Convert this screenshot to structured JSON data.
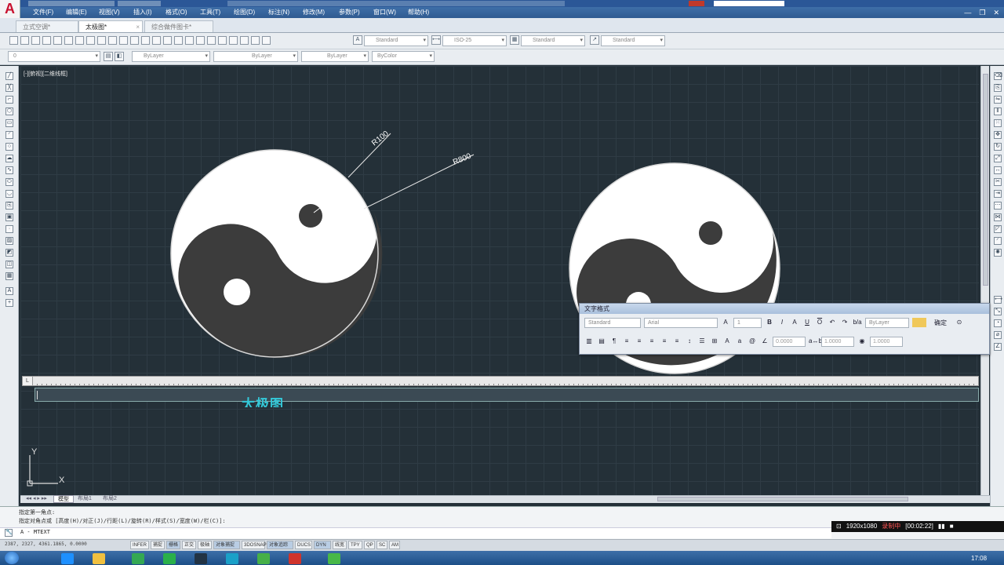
{
  "window": {
    "menus": [
      "文件(F)",
      "编辑(E)",
      "视图(V)",
      "插入(I)",
      "格式(O)",
      "工具(T)",
      "绘图(D)",
      "标注(N)",
      "修改(M)",
      "参数(P)",
      "窗口(W)",
      "帮助(H)"
    ],
    "controls": [
      "—",
      "❐",
      "✕"
    ]
  },
  "tabs": [
    {
      "label": "立式空调*"
    },
    {
      "label": "太极图*"
    },
    {
      "label": "综合做件图卡*"
    }
  ],
  "toolbar": {
    "text_style": "Standard",
    "dim_style": "ISO-25",
    "table_style": "Standard",
    "multileader_style": "Standard",
    "layer": "0",
    "color": "ByLayer",
    "linetype": "ByLayer",
    "lineweight": "ByLayer",
    "plotstyle": "ByColor"
  },
  "viewport": {
    "label": "[-][俯视][二维线框]"
  },
  "drawing": {
    "dim_small": "R100",
    "dim_large": "R800",
    "ucs_x": "X",
    "ucs_y": "Y",
    "colors": {
      "background": "#243038",
      "light": "#ffffff",
      "dark": "#3c3c3c",
      "accent": "#34c8d8"
    }
  },
  "text_format": {
    "title": "文字格式",
    "style": "Standard",
    "font": "Arial",
    "height": "1",
    "color": "ByLayer",
    "ok": "确定",
    "oblique": "0.0000",
    "tracking": "1.0000",
    "width_factor": "1.0000"
  },
  "mtext": {
    "content": "太极图",
    "ruler_corner": "L"
  },
  "layout_tabs": [
    "模型",
    "布局1",
    "布局2"
  ],
  "command": {
    "history_1": "指定第一角点:",
    "history_2": "指定对角点或 [高度(H)/对正(J)/行距(L)/旋转(R)/样式(S)/宽度(W)/栏(C)]:",
    "prompt": "A - MTEXT"
  },
  "recorder": {
    "resolution": "1920x1080",
    "label": "录制中",
    "time": "[00:02:22]"
  },
  "status": {
    "coords": "2387, 2327, 4361.1865, 0.0000",
    "buttons": [
      {
        "label": "INFER",
        "on": false
      },
      {
        "label": "捕捉",
        "on": false
      },
      {
        "label": "栅格",
        "on": true
      },
      {
        "label": "正交",
        "on": false
      },
      {
        "label": "极轴",
        "on": false
      },
      {
        "label": "对象捕捉",
        "on": true
      },
      {
        "label": "3DOSNAP",
        "on": false
      },
      {
        "label": "对象追踪",
        "on": true
      },
      {
        "label": "DUCS",
        "on": false
      },
      {
        "label": "DYN",
        "on": true
      },
      {
        "label": "线宽",
        "on": false
      },
      {
        "label": "TPY",
        "on": false
      },
      {
        "label": "QP",
        "on": false
      },
      {
        "label": "SC",
        "on": false
      },
      {
        "label": "AM",
        "on": false
      }
    ]
  },
  "taskbar": {
    "clock": "17:08"
  }
}
